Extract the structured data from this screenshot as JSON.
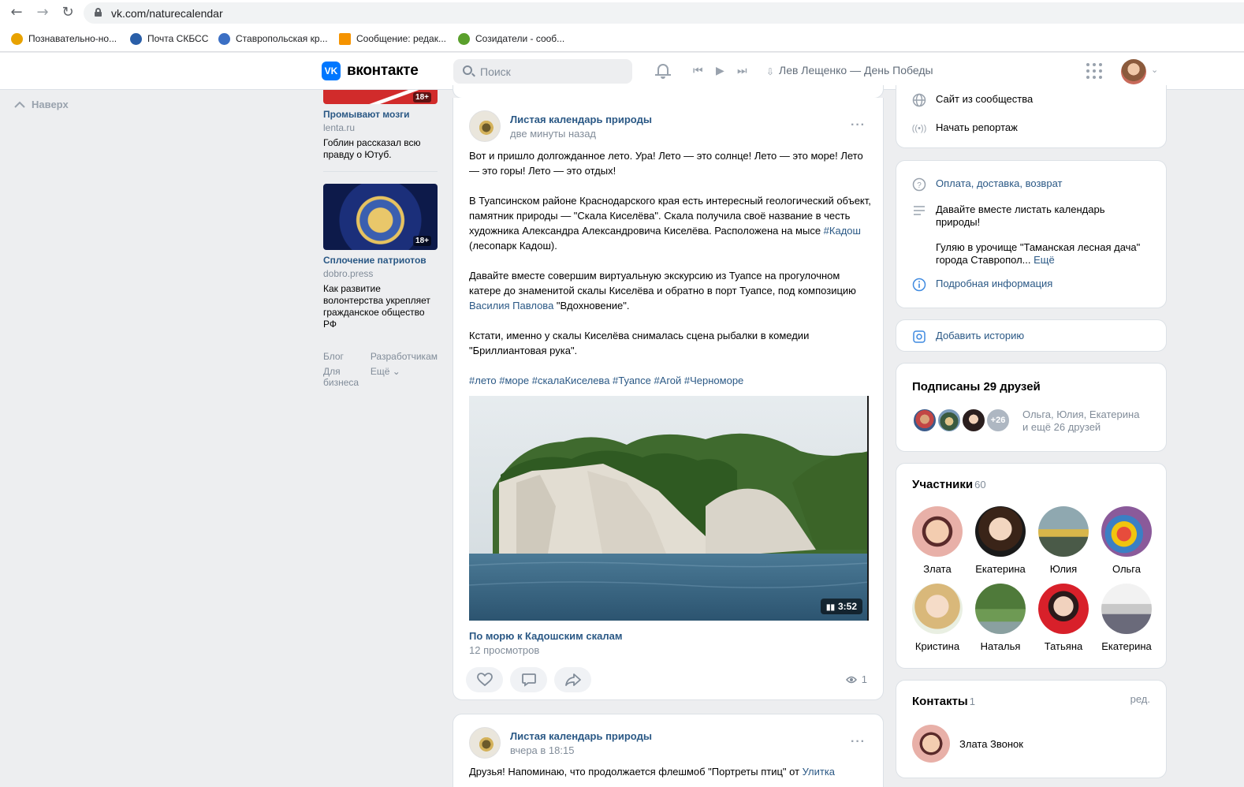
{
  "browser": {
    "url": "vk.com/naturecalendar",
    "bookmarks": [
      {
        "label": "Познавательно-но...",
        "color": "#e8a200"
      },
      {
        "label": "Почта СКБСС",
        "color": "#2a5fa8"
      },
      {
        "label": "Ставропольская кр...",
        "color": "#3b6fc4"
      },
      {
        "label": "Сообщение: редак...",
        "color": "#f59300"
      },
      {
        "label": "Созидатели - сооб...",
        "color": "#5aa02c"
      }
    ]
  },
  "header": {
    "logo_text": "вконтакте",
    "logo_mark": "VK",
    "search_placeholder": "Поиск",
    "now_playing": "Лев Лещенко — День Победы"
  },
  "left": {
    "back_to_top": "Наверх",
    "ads": [
      {
        "title": "Промывают мозги",
        "source": "lenta.ru",
        "text": "Гоблин рассказал всю правду о Ютуб.",
        "age": "18+"
      },
      {
        "title": "Сплочение патриотов",
        "source": "dobro.press",
        "text": "Как развитие волонтерства укрепляет гражданское общество РФ",
        "age": "18+"
      }
    ],
    "footer_links": [
      "Блог",
      "Разработчикам",
      "Для бизнеса",
      "Ещё ⌄"
    ]
  },
  "post": {
    "group": "Листая календарь природы",
    "time": "две минуты назад",
    "p1": "Вот и пришло долгожданное лето. Ура! Лето — это солнце! Лето — это море! Лето — это горы! Лето — это отдых!",
    "p2_a": "В Туапсинском районе Краснодарского края есть интересный геологический объект, памятник природы — \"Скала Киселёва\". Скала получила своё название в честь художника Александра Александровича Киселёва. Расположена на мысе ",
    "p2_link": "#Кадош",
    "p2_b": " (лесопарк Кадош).",
    "p3_a": "Давайте вместе совершим виртуальную экскурсию из Туапсе на прогулочном катере до знаменитой скалы Киселёва и обратно в порт Туапсе, под композицию ",
    "p3_link": "Василия Павлова",
    "p3_b": " \"Вдохновение\".",
    "p4": "Кстати, именно у скалы Киселёва снималась сцена рыбалки в комедии \"Бриллиантовая рука\".",
    "hashtags": "#лето #море #скалаКиселева #Туапсе #Агой #Черноморе",
    "video_duration": "3:52",
    "video_title": "По морю к Кадошским скалам",
    "video_views": "12 просмотров",
    "views": "1"
  },
  "post2": {
    "group": "Листая календарь природы",
    "time": "вчера в 18:15",
    "text_a": "Друзья! Напоминаю, что продолжается флешмоб \"Портреты птиц\" от ",
    "text_link": "Улитка"
  },
  "right": {
    "site_from_community": "Сайт из сообщества",
    "start_stream": "Начать репортаж",
    "payment": "Оплата, доставка, возврат",
    "desc1": "Давайте вместе листать календарь природы!",
    "desc2": "Гуляю в урочище \"Таманская лесная дача\" города Ставропол...",
    "more": "Ещё",
    "details": "Подробная информация",
    "add_story": "Добавить историю",
    "friends_title": "Подписаны 29 друзей",
    "friends_more": "+26",
    "friends_line1": "Ольга, Юлия, Екатерина",
    "friends_line2": "и ещё 26 друзей",
    "members_title": "Участники",
    "members_count": "60",
    "members": [
      "Злата",
      "Екатерина",
      "Юлия",
      "Ольга",
      "Кристина",
      "Наталья",
      "Татьяна",
      "Екатерина"
    ],
    "contacts_title": "Контакты",
    "contacts_count": "1",
    "contacts_edit": "ред.",
    "contact_name": "Злата Звонок"
  }
}
